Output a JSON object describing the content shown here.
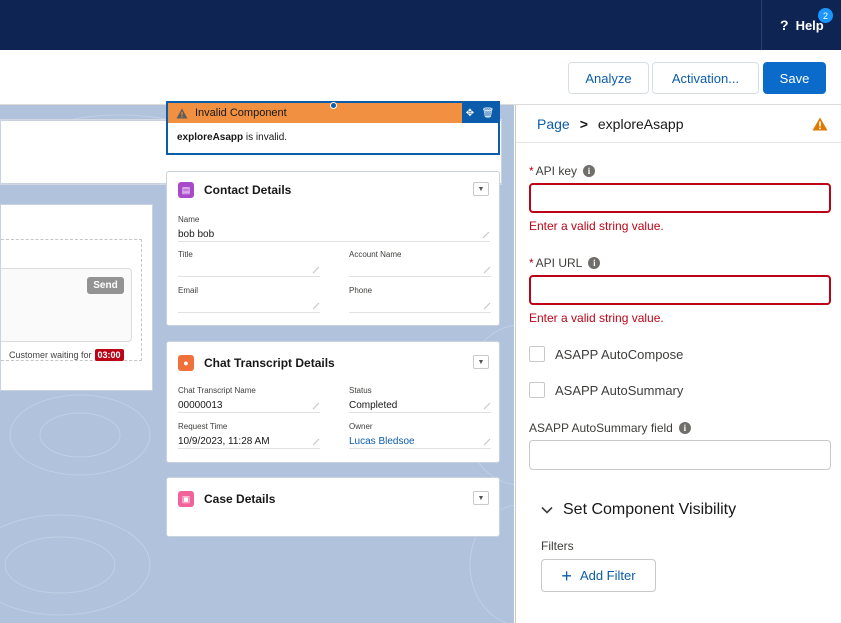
{
  "header": {
    "help_label": "Help",
    "help_badge": "2",
    "help_icon": "question-icon"
  },
  "toolbar": {
    "analyze_label": "Analyze",
    "activation_label": "Activation...",
    "save_label": "Save"
  },
  "canvas": {
    "left_card": {
      "send_label": "Send",
      "waiting_label": "Customer waiting for",
      "waiting_timer": "03:00"
    },
    "invalid_component": {
      "title": "Invalid Component",
      "name": "exploreAsapp",
      "message": "is invalid."
    },
    "contact": {
      "title": "Contact Details",
      "fields": {
        "name": {
          "label": "Name",
          "value": "bob bob"
        },
        "title": {
          "label": "Title",
          "value": ""
        },
        "account": {
          "label": "Account Name",
          "value": ""
        },
        "email": {
          "label": "Email",
          "value": ""
        },
        "phone": {
          "label": "Phone",
          "value": ""
        }
      }
    },
    "chat": {
      "title": "Chat Transcript Details",
      "fields": {
        "transcript_name": {
          "label": "Chat Transcript Name",
          "value": "00000013"
        },
        "status": {
          "label": "Status",
          "value": "Completed"
        },
        "request_time": {
          "label": "Request Time",
          "value": "10/9/2023, 11:28 AM"
        },
        "owner": {
          "label": "Owner",
          "value": "Lucas Bledsoe"
        }
      }
    },
    "case": {
      "title": "Case Details"
    }
  },
  "panel": {
    "breadcrumb": {
      "root": "Page",
      "separator": ">",
      "current": "exploreAsapp"
    },
    "api_key": {
      "label": "API key",
      "required": "*",
      "value": "",
      "error": "Enter a valid string value."
    },
    "api_url": {
      "label": "API URL",
      "required": "*",
      "value": "",
      "error": "Enter a valid string value."
    },
    "autocompose_label": "ASAPP AutoCompose",
    "autosummary_label": "ASAPP AutoSummary",
    "autosummary_field": {
      "label": "ASAPP AutoSummary field",
      "value": ""
    },
    "visibility": {
      "title": "Set Component Visibility",
      "filters_label": "Filters",
      "add_filter_label": "Add Filter"
    }
  },
  "colors": {
    "brand_nav": "#0e2554",
    "accent": "#0b6bcb",
    "error": "#ba0517",
    "warning": "#f09040"
  }
}
